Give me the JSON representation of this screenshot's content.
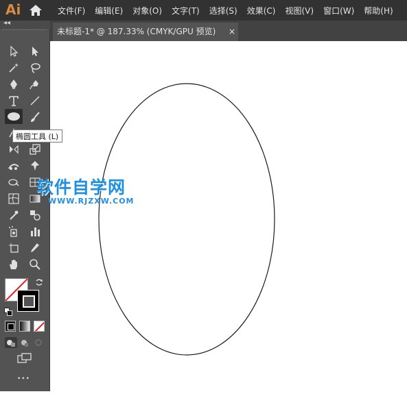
{
  "app": {
    "logo_text": "Ai"
  },
  "menu": [
    "文件(F)",
    "编辑(E)",
    "对象(O)",
    "文字(T)",
    "选择(S)",
    "效果(C)",
    "视图(V)",
    "窗口(W)",
    "帮助(H)"
  ],
  "document_tab": {
    "title": "未标题-1* @ 187.33% (CMYK/GPU 预览)",
    "close_glyph": "×"
  },
  "toolbar": {
    "collapse_glyph": "◂◂",
    "more_glyph": "•••",
    "tools": [
      {
        "name": "selection-tool-icon"
      },
      {
        "name": "direct-selection-tool-icon"
      },
      {
        "name": "magic-wand-tool-icon"
      },
      {
        "name": "lasso-tool-icon"
      },
      {
        "name": "pen-tool-icon"
      },
      {
        "name": "curvature-tool-icon"
      },
      {
        "name": "type-tool-icon"
      },
      {
        "name": "line-segment-tool-icon"
      },
      {
        "name": "ellipse-tool-icon"
      },
      {
        "name": "paintbrush-tool-icon"
      },
      {
        "name": "shaper-tool-icon"
      },
      {
        "name": "eraser-tool-icon"
      },
      {
        "name": "rotate-tool-icon"
      },
      {
        "name": "scale-tool-icon"
      },
      {
        "name": "width-tool-icon"
      },
      {
        "name": "puppet-warp-tool-icon"
      },
      {
        "name": "shape-builder-tool-icon"
      },
      {
        "name": "perspective-grid-tool-icon"
      },
      {
        "name": "mesh-tool-icon"
      },
      {
        "name": "gradient-tool-icon"
      },
      {
        "name": "eyedropper-tool-icon"
      },
      {
        "name": "blend-tool-icon"
      },
      {
        "name": "symbol-sprayer-tool-icon"
      },
      {
        "name": "column-graph-tool-icon"
      },
      {
        "name": "artboard-tool-icon"
      },
      {
        "name": "slice-tool-icon"
      },
      {
        "name": "hand-tool-icon"
      },
      {
        "name": "zoom-tool-icon"
      }
    ]
  },
  "tooltip": {
    "text": "椭圆工具 (L)"
  },
  "watermark": {
    "title": "软件自学网",
    "url": "WWW.RJZXW.COM"
  },
  "colors": {
    "menubar": "#323232",
    "panel": "#535353",
    "logo": "#d88a42",
    "watermark": "#1f8fe0"
  }
}
